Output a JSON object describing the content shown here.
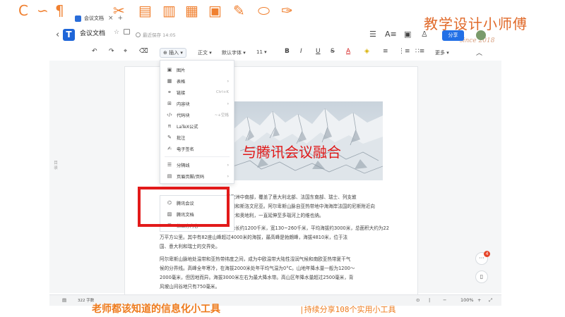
{
  "tab": {
    "title": "会议文档",
    "close": "×",
    "new": "+"
  },
  "brand": {
    "name": "教学设计小师傅",
    "since": "since 2018"
  },
  "header": {
    "back": "‹",
    "logo": "T",
    "title": "会议文档",
    "save_status": "最近保存 14:05",
    "share": "分享"
  },
  "toolbar": {
    "undo": "↶",
    "redo": "↷",
    "format_painter": "⌖",
    "clear": "⌫",
    "insert": "⊕ 插入 ▾",
    "style": "正文 ▾",
    "font": "默认字体 ▾",
    "size": "11 ▾",
    "bold": "B",
    "italic": "I",
    "underline": "U",
    "strike": "S",
    "font_color": "A",
    "highlight": "◈",
    "more": "更多 ▾",
    "collapse": "︿"
  },
  "outline_tab": "目录",
  "insert_menu": {
    "items": [
      {
        "icon": "▣",
        "label": "图片",
        "arrow": "",
        "shortcut": ""
      },
      {
        "icon": "▦",
        "label": "表格",
        "arrow": "›",
        "shortcut": ""
      },
      {
        "icon": "⚭",
        "label": "链接",
        "arrow": "",
        "shortcut": "Ctrl+K"
      },
      {
        "icon": "⊞",
        "label": "内容块",
        "arrow": "›",
        "shortcut": ""
      },
      {
        "icon": "‹/›",
        "label": "代码块",
        "arrow": "",
        "shortcut": "~+空格"
      },
      {
        "icon": "π",
        "label": "LaTeX公式",
        "arrow": "",
        "shortcut": ""
      },
      {
        "icon": "✎",
        "label": "批注",
        "arrow": "",
        "shortcut": ""
      },
      {
        "icon": "✍",
        "label": "电子签名",
        "arrow": "",
        "shortcut": ""
      },
      {
        "icon": "☰",
        "label": "分隔线",
        "arrow": "›",
        "shortcut": ""
      },
      {
        "icon": "▤",
        "label": "页眉页脚/页码",
        "arrow": "›",
        "shortcut": ""
      }
    ],
    "bottom_items": [
      {
        "icon": "⌬",
        "label": "腾讯会议",
        "arrow": ""
      },
      {
        "icon": "▨",
        "label": "腾讯文档",
        "arrow": ""
      },
      {
        "icon": "⊞",
        "label": "第三方内容",
        "arrow": "›"
      }
    ]
  },
  "overlay_title": "与腾讯会议融合",
  "body": {
    "p1": [
      "于欧洲中南部，覆盖了意大利北部、法国东南部、瑞士、列支敦",
      "地利和斯洛文尼亚。阿尔卑斯山脉自亚热带地中海海岸法国的尼斯附近向",
      "瑞士和奥地利，一直延伸至多瑙河上的维也纳。",
      "山脉长约1200千米，宽130~260千米，平均海拔约3000米，总面积大约为22",
      "万平方公里。其中有82座山峰超过4000米的海拔，最高峰是勃朗峰，海拔4810米，位于法",
      "国、意大利和瑞士的交界处。"
    ],
    "p2": [
      "阿尔卑斯山脉地处温带和亚热带纬度之间，成为中欧温带大陆性湿润气候和南欧亚热带夏干气",
      "候的分界线。高峰全年寒冷，在海拔2000米处年平均气温为0°C。山地年降水量一般为1200～",
      "2000毫米，但因地而异。海拔3000米左右为最大降水带。高山区年降水量超过2500毫米，背",
      "风坡山间谷地只有750毫米。"
    ]
  },
  "float": {
    "badge": "4",
    "comment": "···",
    "phone": "▯"
  },
  "statusbar": {
    "outline": "▤",
    "word_count": "322 字数",
    "play": "⊙",
    "zoom_out": "−",
    "zoom_in": "+",
    "zoom": "100%",
    "fit": "⤢"
  },
  "caption": {
    "main": "老师都该知道的信息化小工具",
    "sub": "|持续分享108个实用小工具"
  },
  "colors": {
    "accent": "#2370e6",
    "highlight": "#e21a1a",
    "caption": "#ee7b1d"
  }
}
